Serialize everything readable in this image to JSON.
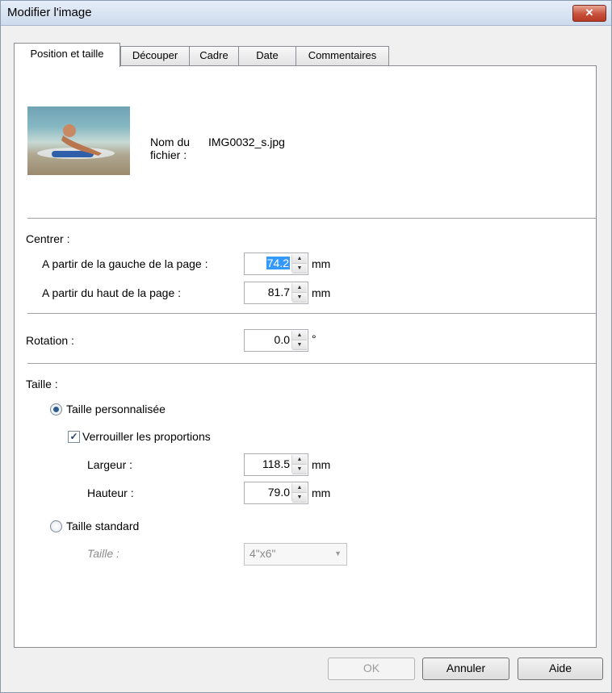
{
  "window": {
    "title": "Modifier l'image",
    "close_glyph": "✕"
  },
  "tabs": [
    {
      "label": "Position et taille",
      "active": true
    },
    {
      "label": "Découper",
      "active": false
    },
    {
      "label": "Cadre",
      "active": false
    },
    {
      "label": "Date",
      "active": false
    },
    {
      "label": "Commentaires",
      "active": false
    }
  ],
  "file": {
    "name_label": "Nom du\nfichier :",
    "name_value": "IMG0032_s.jpg"
  },
  "center": {
    "heading": "Centrer :",
    "left_label": "A partir de la gauche de la page :",
    "left_value": "74.2",
    "top_label": "A partir du haut de la page :",
    "top_value": "81.7",
    "unit": "mm"
  },
  "rotation": {
    "label": "Rotation :",
    "value": "0.0",
    "unit": "°"
  },
  "size": {
    "heading": "Taille :",
    "custom_label": "Taille personnalisée",
    "custom_selected": true,
    "lock_label": "Verrouiller les proportions",
    "lock_checked": true,
    "width_label": "Largeur :",
    "width_value": "118.5",
    "height_label": "Hauteur :",
    "height_value": "79.0",
    "unit": "mm",
    "standard_label": "Taille standard",
    "standard_selected": false,
    "standard_size_label": "Taille :",
    "standard_size_value": "4\"x6\""
  },
  "buttons": {
    "ok": "OK",
    "cancel": "Annuler",
    "help": "Aide"
  },
  "colors": {
    "selection": "#3399ff",
    "close": "#c8503a"
  },
  "icons": {
    "close": "close-icon",
    "spin_up": "▲",
    "spin_down": "▼",
    "dropdown": "▼",
    "check": "✓"
  }
}
